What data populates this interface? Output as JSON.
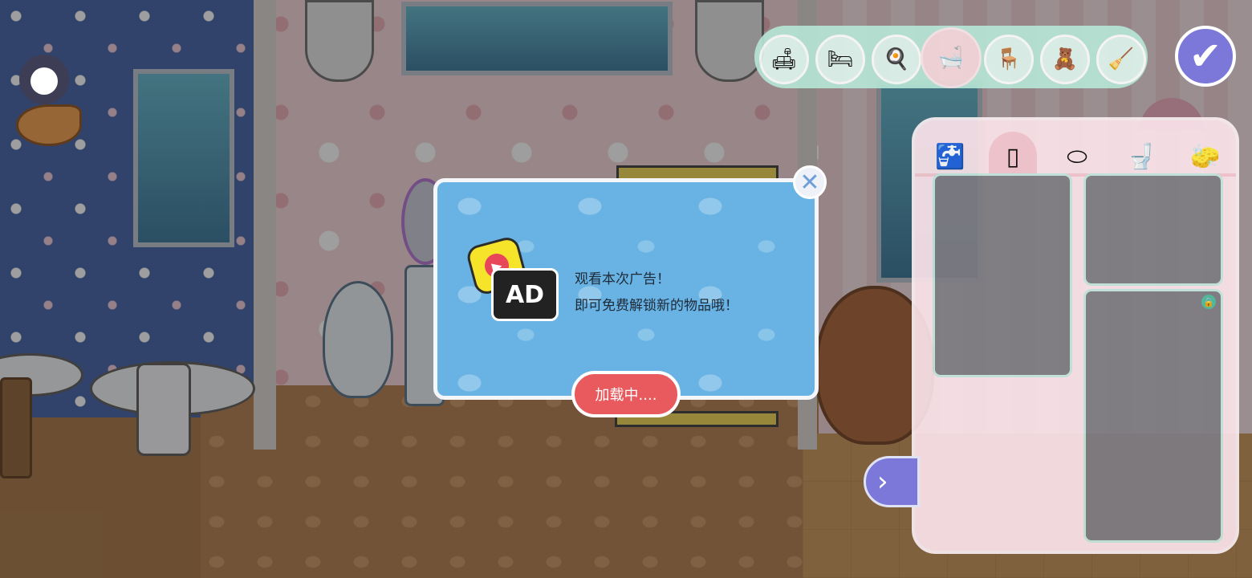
{
  "toolbar": {
    "categories": [
      {
        "name": "sofa",
        "icon": "🛋"
      },
      {
        "name": "bed",
        "icon": "🛏"
      },
      {
        "name": "kitchen",
        "icon": "🍳"
      },
      {
        "name": "bathroom",
        "icon": "🛁"
      },
      {
        "name": "table",
        "icon": "🪑"
      },
      {
        "name": "decor",
        "icon": "🧸"
      },
      {
        "name": "tools",
        "icon": "🧹"
      }
    ],
    "selected_index": 3,
    "confirm_icon": "✔"
  },
  "panel": {
    "tabs": [
      {
        "name": "sink",
        "icon": "🚰"
      },
      {
        "name": "shower-door",
        "icon": "▯"
      },
      {
        "name": "mirror",
        "icon": "⬭"
      },
      {
        "name": "toilet",
        "icon": "🚽"
      },
      {
        "name": "soap",
        "icon": "🧽"
      }
    ],
    "selected_tab": 1,
    "lock_icon": "🔒"
  },
  "next_icon": "›",
  "ad": {
    "badge": "AD",
    "line1": "观看本次广告！",
    "line2": "即可免费解锁新的物品哦！",
    "button": "加载中....",
    "close_icon": "✕",
    "play_icon": "▶"
  }
}
